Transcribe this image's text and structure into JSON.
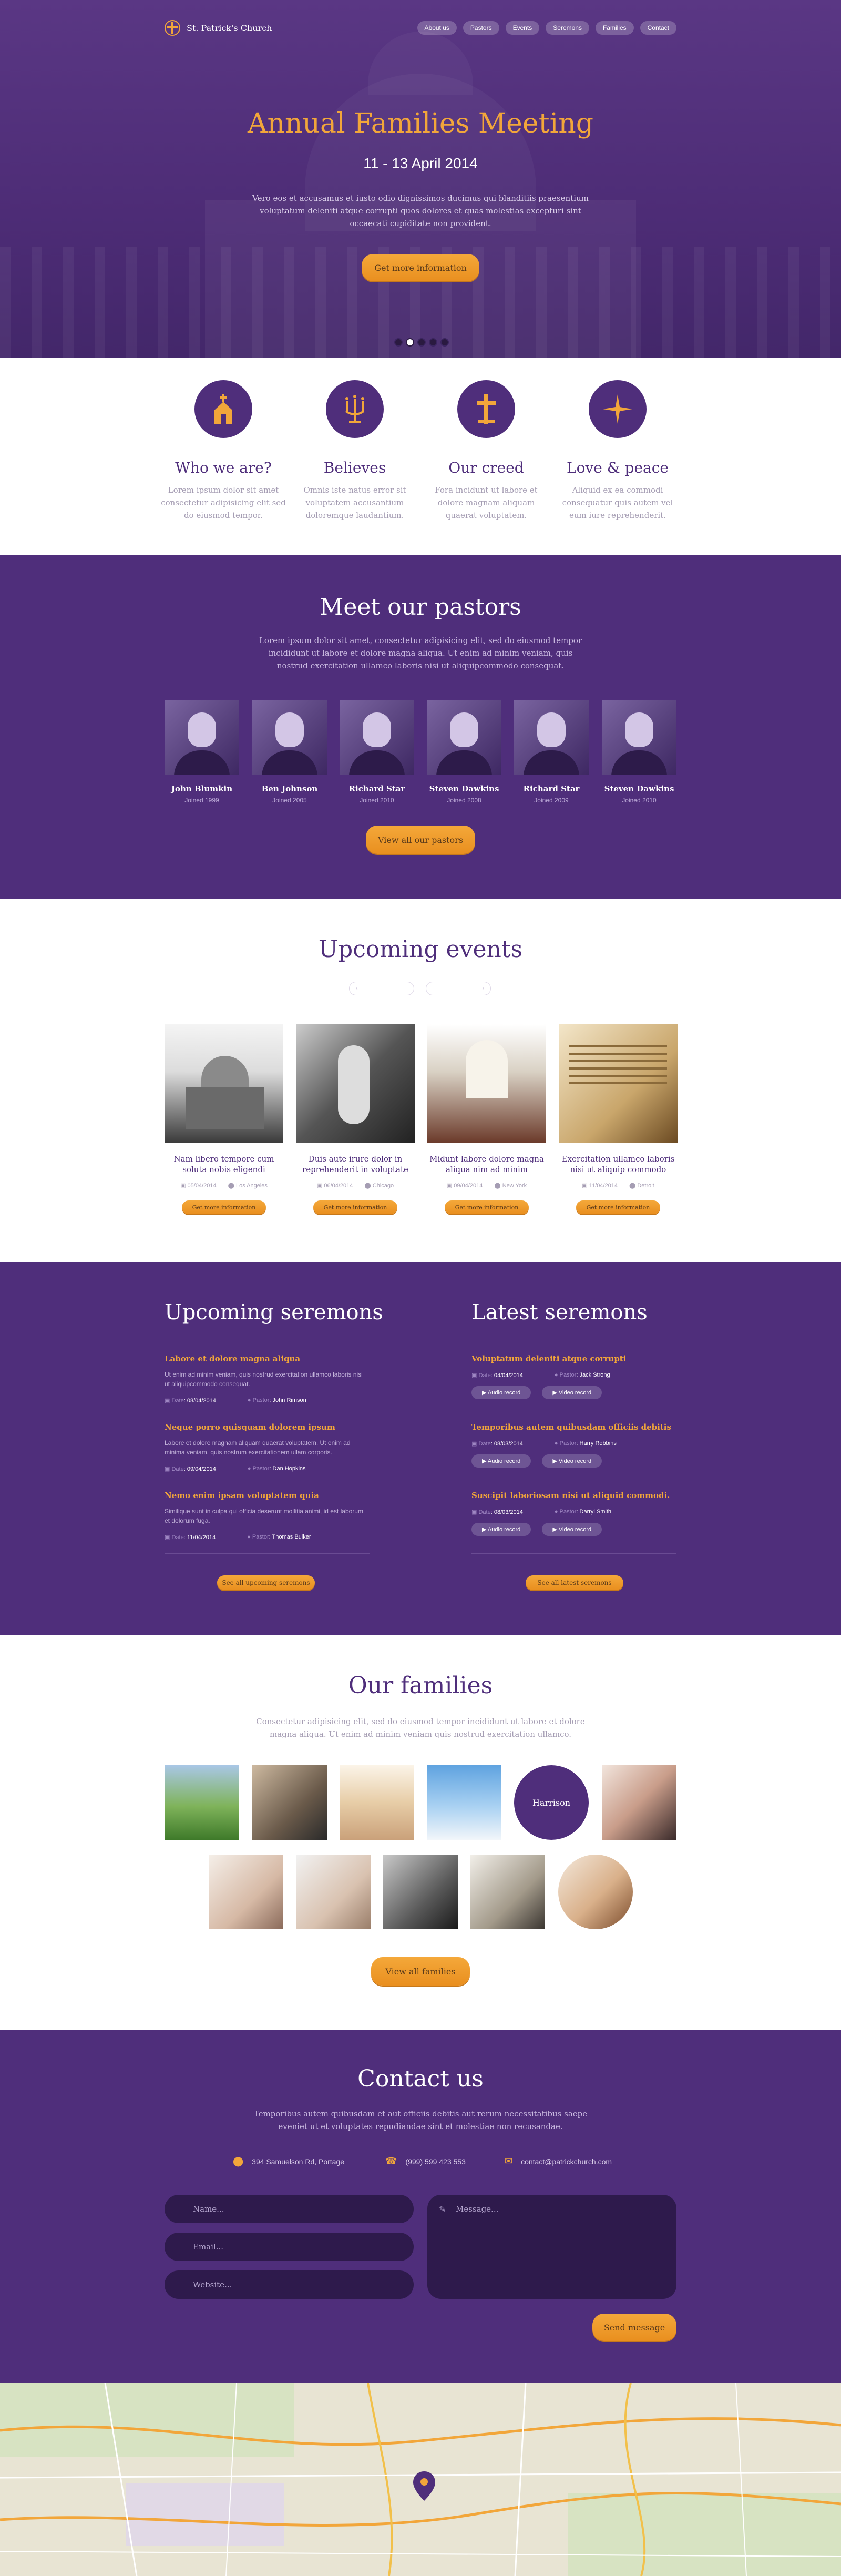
{
  "brand": {
    "name": "St. Patrick's Church"
  },
  "nav": [
    "About us",
    "Pastors",
    "Events",
    "Seremons",
    "Families",
    "Contact"
  ],
  "hero": {
    "title": "Annual Families Meeting",
    "date": "11 - 13 April 2014",
    "text": "Vero eos et accusamus et iusto odio dignissimos ducimus qui blanditiis praesentium voluptatum deleniti atque corrupti quos dolores et quas molestias excepturi sint occaecati cupiditate non provident.",
    "button": "Get more information",
    "slides": 5,
    "active_slide": 2
  },
  "features": [
    {
      "title": "Who we are?",
      "text": "Lorem ipsum dolor sit amet consectetur adipisicing elit sed do eiusmod tempor.",
      "icon": "church-icon"
    },
    {
      "title": "Believes",
      "text": "Omnis iste natus error sit voluptatem accusantium doloremque laudantium.",
      "icon": "candelabrum-icon"
    },
    {
      "title": "Our creed",
      "text": "Fora incidunt ut labore et dolore magnam aliquam quaerat voluptatem.",
      "icon": "cross-icon"
    },
    {
      "title": "Love & peace",
      "text": "Aliquid ex ea commodi consequatur quis autem vel eum iure reprehenderit.",
      "icon": "star-icon"
    }
  ],
  "pastors": {
    "title": "Meet our pastors",
    "text": "Lorem ipsum dolor sit amet, consectetur adipisicing elit, sed do eiusmod tempor incididunt ut labore et dolore magna aliqua. Ut enim ad minim veniam, quis nostrud exercitation ullamco laboris nisi ut aliquipcommodo consequat.",
    "items": [
      {
        "name": "John Blumkin",
        "joined": "Joined 1999"
      },
      {
        "name": "Ben Johnson",
        "joined": "Joined 2005"
      },
      {
        "name": "Richard Star",
        "joined": "Joined 2010"
      },
      {
        "name": "Steven Dawkins",
        "joined": "Joined 2008"
      },
      {
        "name": "Richard Star",
        "joined": "Joined 2009"
      },
      {
        "name": "Steven Dawkins",
        "joined": "Joined 2010"
      }
    ],
    "button": "View all our pastors"
  },
  "events": {
    "title": "Upcoming events",
    "items": [
      {
        "title": "Nam libero tempore cum soluta nobis eligendi",
        "date": "05/04/2014",
        "location": "Los Angeles",
        "button": "Get more information"
      },
      {
        "title": "Duis aute irure dolor in reprehenderit in voluptate",
        "date": "06/04/2014",
        "location": "Chicago",
        "button": "Get more information"
      },
      {
        "title": "Midunt labore dolore magna aliqua nim ad minim",
        "date": "09/04/2014",
        "location": "New York",
        "button": "Get more information"
      },
      {
        "title": "Exercitation ullamco laboris nisi ut aliquip commodo",
        "date": "11/04/2014",
        "location": "Detroit",
        "button": "Get more information"
      }
    ]
  },
  "upcoming_sermons": {
    "title": "Upcoming seremons",
    "date_label": "Date",
    "pastor_label": "Pastor",
    "items": [
      {
        "title": "Labore et dolore magna aliqua",
        "text": "Ut enim ad minim veniam, quis nostrud exercitation ullamco laboris nisi ut aliquipcommodo consequat.",
        "date": "08/04/2014",
        "pastor": "John Rimson"
      },
      {
        "title": "Neque porro quisquam dolorem ipsum",
        "text": "Labore et dolore magnam aliquam quaerat voluptatem. Ut enim ad minima veniam, quis nostrum exercitationem ullam corporis.",
        "date": "09/04/2014",
        "pastor": "Dan Hopkins"
      },
      {
        "title": "Nemo enim ipsam voluptatem quia",
        "text": "Similique sunt in culpa qui officia deserunt mollitia animi, id est laborum et dolorum fuga.",
        "date": "11/04/2014",
        "pastor": "Thomas Bulker"
      }
    ],
    "button": "See all upcoming seremons"
  },
  "latest_sermons": {
    "title": "Latest seremons",
    "date_label": "Date",
    "pastor_label": "Pastor",
    "audio_label": "Audio record",
    "video_label": "Video record",
    "items": [
      {
        "title": "Voluptatum deleniti atque corrupti",
        "date": "04/04/2014",
        "pastor": "Jack Strong"
      },
      {
        "title": "Temporibus autem quibusdam officiis debitis",
        "date": "08/03/2014",
        "pastor": "Harry Robbins"
      },
      {
        "title": "Suscipit laboriosam nisi ut aliquid commodi.",
        "date": "08/03/2014",
        "pastor": "Darryl Smith"
      }
    ],
    "button": "See all latest seremons"
  },
  "families": {
    "title": "Our families",
    "text": "Consectetur adipisicing elit, sed do eiusmod tempor incididunt ut labore et dolore magna aliqua. Ut enim ad minim veniam quis nostrud exercitation ullamco.",
    "highlight": "Harrison",
    "button": "View all families"
  },
  "contact": {
    "title": "Contact us",
    "text": "Temporibus autem quibusdam et aut officiis debitis aut rerum necessitatibus saepe eveniet ut et voluptates repudiandae sint et molestiae non recusandae.",
    "address": "394 Samuelson Rd, Portage",
    "phone": "(999) 599 423 553",
    "email": "contact@patrickchurch.com",
    "name_placeholder": "Name...",
    "email_placeholder": "Email...",
    "website_placeholder": "Website...",
    "message_placeholder": "Message...",
    "button": "Send message"
  },
  "map": {
    "pin_icon": "map-pin-icon"
  },
  "colors": {
    "primary": "#4f2e7b",
    "accent": "#f2a63a",
    "field": "#2e1a4c"
  }
}
